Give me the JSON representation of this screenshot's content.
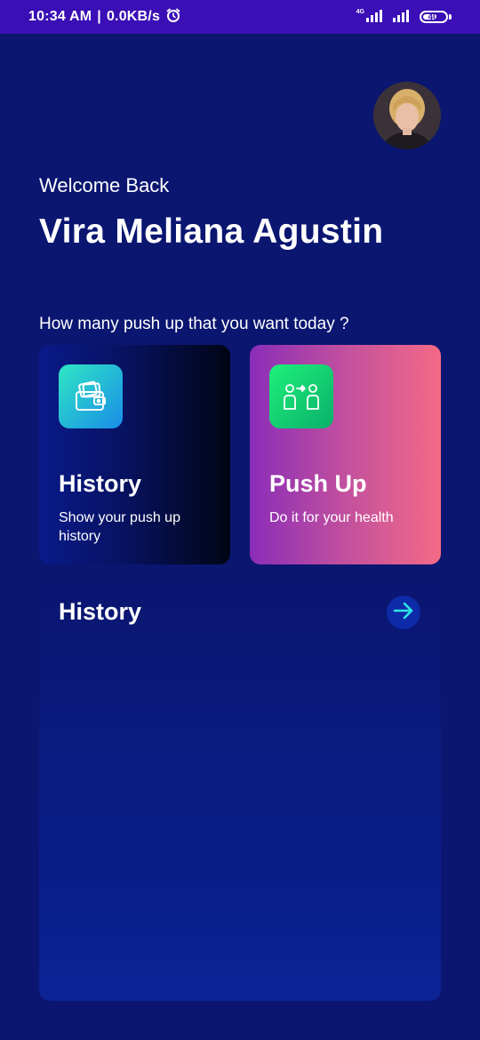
{
  "status_bar": {
    "time": "10:34 AM",
    "separator": "|",
    "net_speed": "0.0KB/s",
    "network_type": "4G",
    "battery": "40"
  },
  "header": {
    "welcome": "Welcome Back",
    "user_name": "Vira Meliana Agustin",
    "avatar_icon": "user-avatar"
  },
  "prompt": {
    "question": "How many push up that you want today ?"
  },
  "cards": [
    {
      "title": "History",
      "description": "Show your push up history",
      "icon": "wallet-icon"
    },
    {
      "title": "Push Up",
      "description": "Do it for your health",
      "icon": "people-exchange-icon"
    }
  ],
  "history_section": {
    "title": "History",
    "action_icon": "arrow-right-icon"
  },
  "colors": {
    "background": "#0a1670",
    "status_bar": "#3a0fb5",
    "push_card_start": "#8a2db8",
    "push_card_end": "#f46a86",
    "arrow_accent": "#2ee6e6"
  }
}
